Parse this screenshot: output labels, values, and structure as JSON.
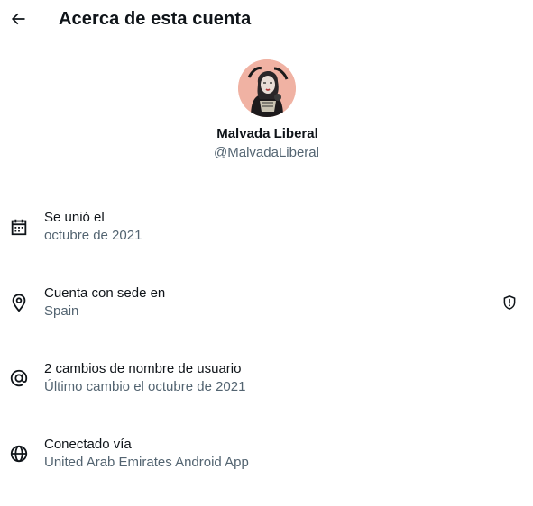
{
  "header": {
    "title": "Acerca de esta cuenta"
  },
  "profile": {
    "display_name": "Malvada Liberal",
    "handle": "@MalvadaLiberal"
  },
  "rows": [
    {
      "icon": "calendar-icon",
      "label": "Se unió el",
      "value": "octubre de 2021"
    },
    {
      "icon": "location-pin-icon",
      "label": "Cuenta con sede en",
      "value": "Spain",
      "extra_icon": "shield-alert-icon"
    },
    {
      "icon": "at-sign-icon",
      "label": "2 cambios de nombre de usuario",
      "value": "Último cambio el octubre de 2021"
    },
    {
      "icon": "globe-icon",
      "label": "Conectado vía",
      "value": "United Arab Emirates Android App"
    }
  ],
  "colors": {
    "text_primary": "#0f1419",
    "text_secondary": "#536471"
  }
}
